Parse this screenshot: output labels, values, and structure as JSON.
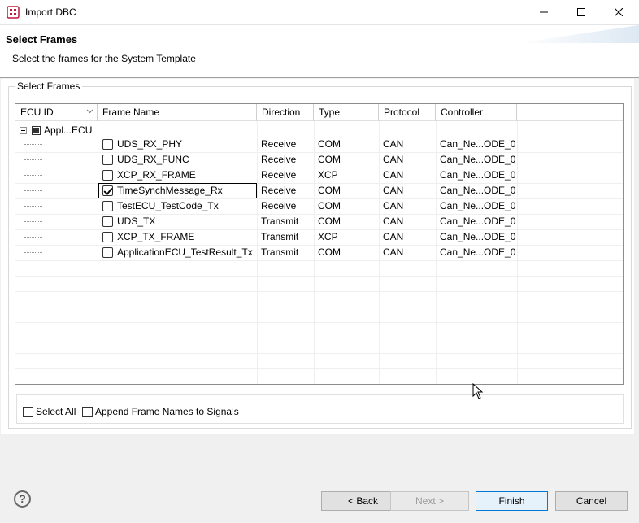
{
  "window": {
    "title": "Import DBC"
  },
  "header": {
    "title": "Select Frames",
    "description": "Select the frames for the System Template"
  },
  "group": {
    "label": "Select Frames"
  },
  "table": {
    "columns": [
      "ECU ID",
      "Frame Name",
      "Direction",
      "Type",
      "Protocol",
      "Controller"
    ],
    "root": {
      "label": "Appl...ECU",
      "state": "partial"
    },
    "rows": [
      {
        "name": "UDS_RX_PHY",
        "direction": "Receive",
        "type": "COM",
        "protocol": "CAN",
        "controller": "Can_Ne...ODE_0",
        "checked": false
      },
      {
        "name": "UDS_RX_FUNC",
        "direction": "Receive",
        "type": "COM",
        "protocol": "CAN",
        "controller": "Can_Ne...ODE_0",
        "checked": false
      },
      {
        "name": "XCP_RX_FRAME",
        "direction": "Receive",
        "type": "XCP",
        "protocol": "CAN",
        "controller": "Can_Ne...ODE_0",
        "checked": false
      },
      {
        "name": "TimeSynchMessage_Rx",
        "direction": "Receive",
        "type": "COM",
        "protocol": "CAN",
        "controller": "Can_Ne...ODE_0",
        "checked": true
      },
      {
        "name": "TestECU_TestCode_Tx",
        "direction": "Receive",
        "type": "COM",
        "protocol": "CAN",
        "controller": "Can_Ne...ODE_0",
        "checked": false
      },
      {
        "name": "UDS_TX",
        "direction": "Transmit",
        "type": "COM",
        "protocol": "CAN",
        "controller": "Can_Ne...ODE_0",
        "checked": false
      },
      {
        "name": "XCP_TX_FRAME",
        "direction": "Transmit",
        "type": "XCP",
        "protocol": "CAN",
        "controller": "Can_Ne...ODE_0",
        "checked": false
      },
      {
        "name": "ApplicationECU_TestResult_Tx",
        "direction": "Transmit",
        "type": "COM",
        "protocol": "CAN",
        "controller": "Can_Ne...ODE_0",
        "checked": false
      }
    ]
  },
  "options": {
    "select_all": "Select All",
    "append_names": "Append Frame Names to Signals"
  },
  "buttons": {
    "help": "?",
    "back": "< Back",
    "next": "Next >",
    "finish": "Finish",
    "cancel": "Cancel"
  }
}
